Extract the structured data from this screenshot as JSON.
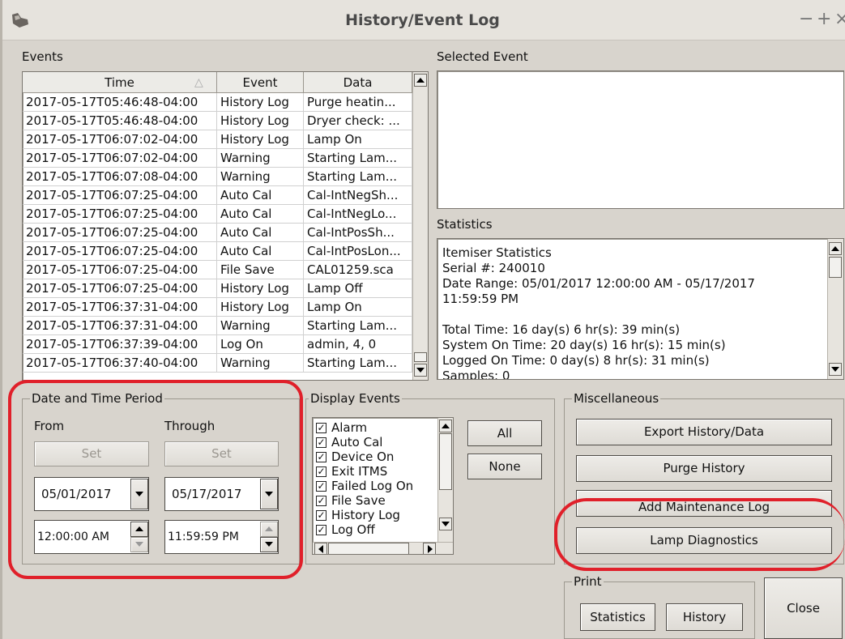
{
  "window": {
    "title": "History/Event Log",
    "min": "−",
    "max": "+",
    "close": "×"
  },
  "events": {
    "label": "Events",
    "columns": [
      "Time",
      "Event",
      "Data"
    ],
    "rows": [
      [
        "2017-05-17T05:46:48-04:00",
        "History Log",
        "Purge heatin..."
      ],
      [
        "2017-05-17T05:46:48-04:00",
        "History Log",
        "Dryer check: ..."
      ],
      [
        "2017-05-17T06:07:02-04:00",
        "History Log",
        "Lamp On"
      ],
      [
        "2017-05-17T06:07:02-04:00",
        "Warning",
        "Starting Lam..."
      ],
      [
        "2017-05-17T06:07:08-04:00",
        "Warning",
        "Starting Lam..."
      ],
      [
        "2017-05-17T06:07:25-04:00",
        "Auto Cal",
        "Cal-IntNegSh..."
      ],
      [
        "2017-05-17T06:07:25-04:00",
        "Auto Cal",
        "Cal-IntNegLo..."
      ],
      [
        "2017-05-17T06:07:25-04:00",
        "Auto Cal",
        "Cal-IntPosSh..."
      ],
      [
        "2017-05-17T06:07:25-04:00",
        "Auto Cal",
        "Cal-IntPosLon..."
      ],
      [
        "2017-05-17T06:07:25-04:00",
        "File Save",
        "CAL01259.sca"
      ],
      [
        "2017-05-17T06:07:25-04:00",
        "History Log",
        "Lamp Off"
      ],
      [
        "2017-05-17T06:37:31-04:00",
        "History Log",
        "Lamp On"
      ],
      [
        "2017-05-17T06:37:31-04:00",
        "Warning",
        "Starting Lam..."
      ],
      [
        "2017-05-17T06:37:39-04:00",
        "Log On",
        "admin, 4, 0"
      ],
      [
        "2017-05-17T06:37:40-04:00",
        "Warning",
        "Starting Lam..."
      ]
    ]
  },
  "selected_event": {
    "label": "Selected Event"
  },
  "statistics": {
    "label": "Statistics",
    "lines": [
      "Itemiser Statistics",
      "Serial #: 240010",
      "Date Range: 05/01/2017 12:00:00 AM - 05/17/2017",
      "11:59:59 PM",
      "",
      "Total Time: 16 day(s) 6 hr(s): 39 min(s)",
      "System On Time: 20 day(s) 16 hr(s): 15 min(s)",
      "Logged On Time: 0 day(s) 8 hr(s): 31 min(s)",
      "Samples: 0"
    ]
  },
  "date_period": {
    "label": "Date and Time Period",
    "from_label": "From",
    "through_label": "Through",
    "set_label": "Set",
    "from_date": "05/01/2017",
    "through_date": "05/17/2017",
    "from_time": "12:00:00 AM",
    "through_time": "11:59:59 PM"
  },
  "display_events": {
    "label": "Display Events",
    "items": [
      "Alarm",
      "Auto Cal",
      "Device On",
      "Exit ITMS",
      "Failed Log On",
      "File Save",
      "History Log",
      "Log Off"
    ],
    "all_label": "All",
    "none_label": "None"
  },
  "misc": {
    "label": "Miscellaneous",
    "export": "Export History/Data",
    "purge": "Purge History",
    "maintenance": "Add Maintenance Log",
    "lamp": "Lamp Diagnostics"
  },
  "print": {
    "label": "Print",
    "statistics": "Statistics",
    "history": "History"
  },
  "close_label": "Close",
  "colors": {
    "annotation": "#e0202a",
    "window_bg": "#d8d4cd"
  }
}
